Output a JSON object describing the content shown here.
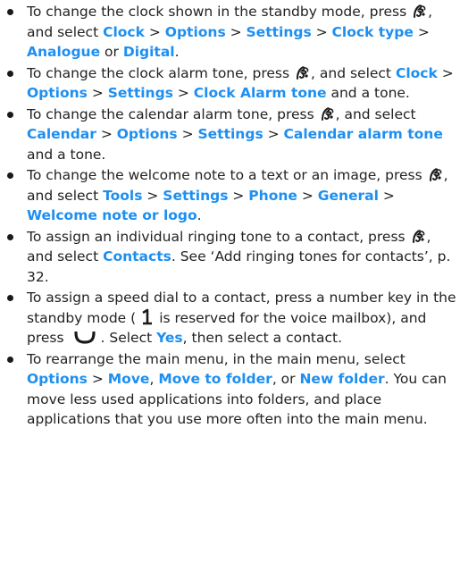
{
  "tips": [
    {
      "parts": [
        {
          "t": "To change the clock shown in the standby mode, press "
        },
        {
          "icon": "menu-key-icon"
        },
        {
          "t": ", and select "
        },
        {
          "ui": "Clock"
        },
        {
          "t": " > "
        },
        {
          "ui": "Options"
        },
        {
          "t": " > "
        },
        {
          "ui": "Settings"
        },
        {
          "t": " > "
        },
        {
          "ui": "Clock type"
        },
        {
          "t": " > "
        },
        {
          "ui": "Analogue"
        },
        {
          "t": " or "
        },
        {
          "ui": "Digital"
        },
        {
          "t": "."
        }
      ]
    },
    {
      "parts": [
        {
          "t": "To change the clock alarm tone, press "
        },
        {
          "icon": "menu-key-icon"
        },
        {
          "t": ", and select "
        },
        {
          "ui": "Clock"
        },
        {
          "t": " > "
        },
        {
          "ui": "Options"
        },
        {
          "t": " > "
        },
        {
          "ui": "Settings"
        },
        {
          "t": " > "
        },
        {
          "ui": "Clock Alarm tone"
        },
        {
          "t": " and a tone."
        }
      ]
    },
    {
      "parts": [
        {
          "t": "To change the calendar alarm tone, press "
        },
        {
          "icon": "menu-key-icon"
        },
        {
          "t": ", and select "
        },
        {
          "ui": "Calendar"
        },
        {
          "t": " > "
        },
        {
          "ui": "Options"
        },
        {
          "t": " > "
        },
        {
          "ui": "Settings"
        },
        {
          "t": " > "
        },
        {
          "ui": "Calendar alarm tone"
        },
        {
          "t": " and a tone."
        }
      ]
    },
    {
      "parts": [
        {
          "t": "To change the welcome note to a text or an image, press "
        },
        {
          "icon": "menu-key-icon"
        },
        {
          "t": ", and select "
        },
        {
          "ui": "Tools"
        },
        {
          "t": " > "
        },
        {
          "ui": "Settings"
        },
        {
          "t": " > "
        },
        {
          "ui": "Phone"
        },
        {
          "t": " > "
        },
        {
          "ui": "General"
        },
        {
          "t": " > "
        },
        {
          "ui": "Welcome note or logo"
        },
        {
          "t": "."
        }
      ]
    },
    {
      "parts": [
        {
          "t": "To assign an individual ringing tone to a contact, press "
        },
        {
          "icon": "menu-key-icon"
        },
        {
          "t": ", and select "
        },
        {
          "ui": "Contacts"
        },
        {
          "t": ". See ‘Add ringing tones for contacts’, p. 32."
        }
      ]
    },
    {
      "parts": [
        {
          "t": "To assign a speed dial to a contact, press a number key in the standby mode ("
        },
        {
          "icon": "number-one-key-icon"
        },
        {
          "t": "is reserved for the voice mailbox), and press "
        },
        {
          "icon": "call-key-icon"
        },
        {
          "t": ". Select "
        },
        {
          "ui": "Yes"
        },
        {
          "t": ", then select a contact."
        }
      ]
    },
    {
      "parts": [
        {
          "t": "To rearrange the main menu, in the main menu, select "
        },
        {
          "ui": "Options"
        },
        {
          "t": " > "
        },
        {
          "ui": "Move"
        },
        {
          "t": ", "
        },
        {
          "ui": "Move to folder"
        },
        {
          "t": ", or "
        },
        {
          "ui": "New folder"
        },
        {
          "t": ". You can move less used applications into folders, and place applications that you use more often into the main menu."
        }
      ]
    }
  ],
  "colors": {
    "ui_term": "#1e8ff0",
    "body_text": "#222222",
    "bullet": "#1a1a1a"
  }
}
